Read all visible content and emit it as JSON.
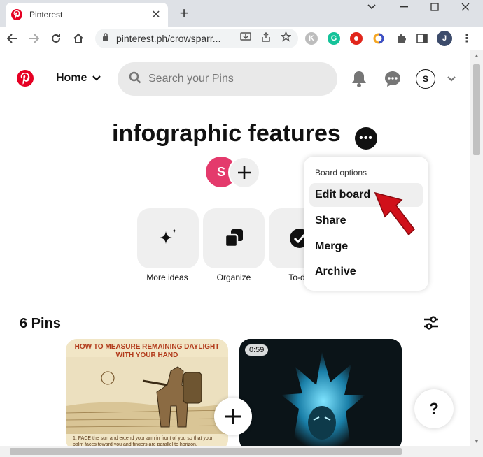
{
  "browser": {
    "tab_title": "Pinterest",
    "tab_close": "✕",
    "new_tab": "+",
    "url": "pinterest.ph/crowsparr...",
    "profile_initial": "J",
    "ext_k": "K",
    "ext_g": "G"
  },
  "header": {
    "home_label": "Home",
    "search_placeholder": "Search your Pins",
    "avatar_initial": "S"
  },
  "board": {
    "title": "infographic features",
    "collaborator_initial": "S"
  },
  "tools": [
    {
      "label": "More ideas"
    },
    {
      "label": "Organize"
    },
    {
      "label": "To-d"
    }
  ],
  "board_options_menu": {
    "header": "Board options",
    "items": [
      {
        "label": "Edit board"
      },
      {
        "label": "Share"
      },
      {
        "label": "Merge"
      },
      {
        "label": "Archive"
      }
    ]
  },
  "pins": {
    "count_label": "6 Pins",
    "pin1_title": "HOW TO MEASURE REMAINING DAYLIGHT WITH YOUR HAND",
    "pin1_caption": "1: FACE the sun and extend your arm in front of you so that your palm faces toward you and fingers are parallel to horizon.",
    "pin2_duration": "0:59"
  },
  "help_label": "?",
  "colors": {
    "brand": "#e60023",
    "arrow": "#d0101a"
  }
}
